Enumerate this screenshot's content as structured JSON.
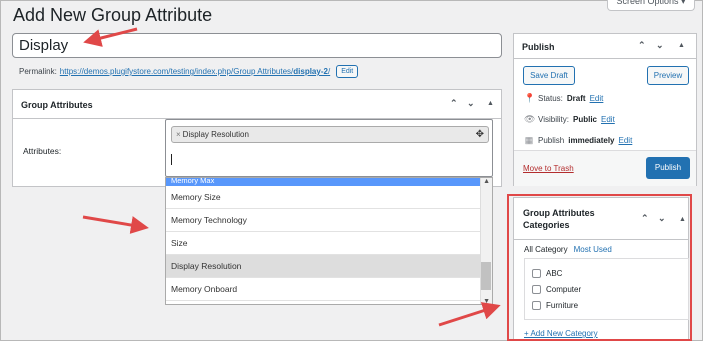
{
  "screen_options": "Screen Options ▾",
  "page_title": "Add New Group Attribute",
  "title_value": "Display",
  "permalink": {
    "label": "Permalink:",
    "url_prefix": "https://demos.plugifystore.com/testing/index.php/Group Attributes/",
    "slug": "display-2",
    "url_suffix": "/",
    "edit": "Edit"
  },
  "group_attributes": {
    "title": "Group Attributes",
    "attributes_label": "Attributes:",
    "selected_tag": "Display Resolution",
    "tag_remove": "×",
    "options": [
      "Memory Max",
      "Memory Size",
      "Memory Technology",
      "Size",
      "Display Resolution",
      "Memory Onboard"
    ],
    "selected_option": "Display Resolution"
  },
  "publish": {
    "title": "Publish",
    "save_draft": "Save Draft",
    "preview": "Preview",
    "status_label": "Status:",
    "status_value": "Draft",
    "visibility_label": "Visibility:",
    "visibility_value": "Public",
    "publish_label": "Publish",
    "publish_value": "immediately",
    "edit": "Edit",
    "move_to_trash": "Move to Trash",
    "publish_button": "Publish"
  },
  "categories": {
    "title_line1": "Group Attributes",
    "title_line2": "Categories",
    "tab_all": "All Category",
    "tab_most_used": "Most Used",
    "items": [
      "ABC",
      "Computer",
      "Furniture"
    ],
    "add_new": "+ Add New Category"
  },
  "colors": {
    "accent": "#2271b1",
    "highlight": "#5897fb",
    "annotation": "#e04848",
    "danger": "#b32d2e"
  }
}
